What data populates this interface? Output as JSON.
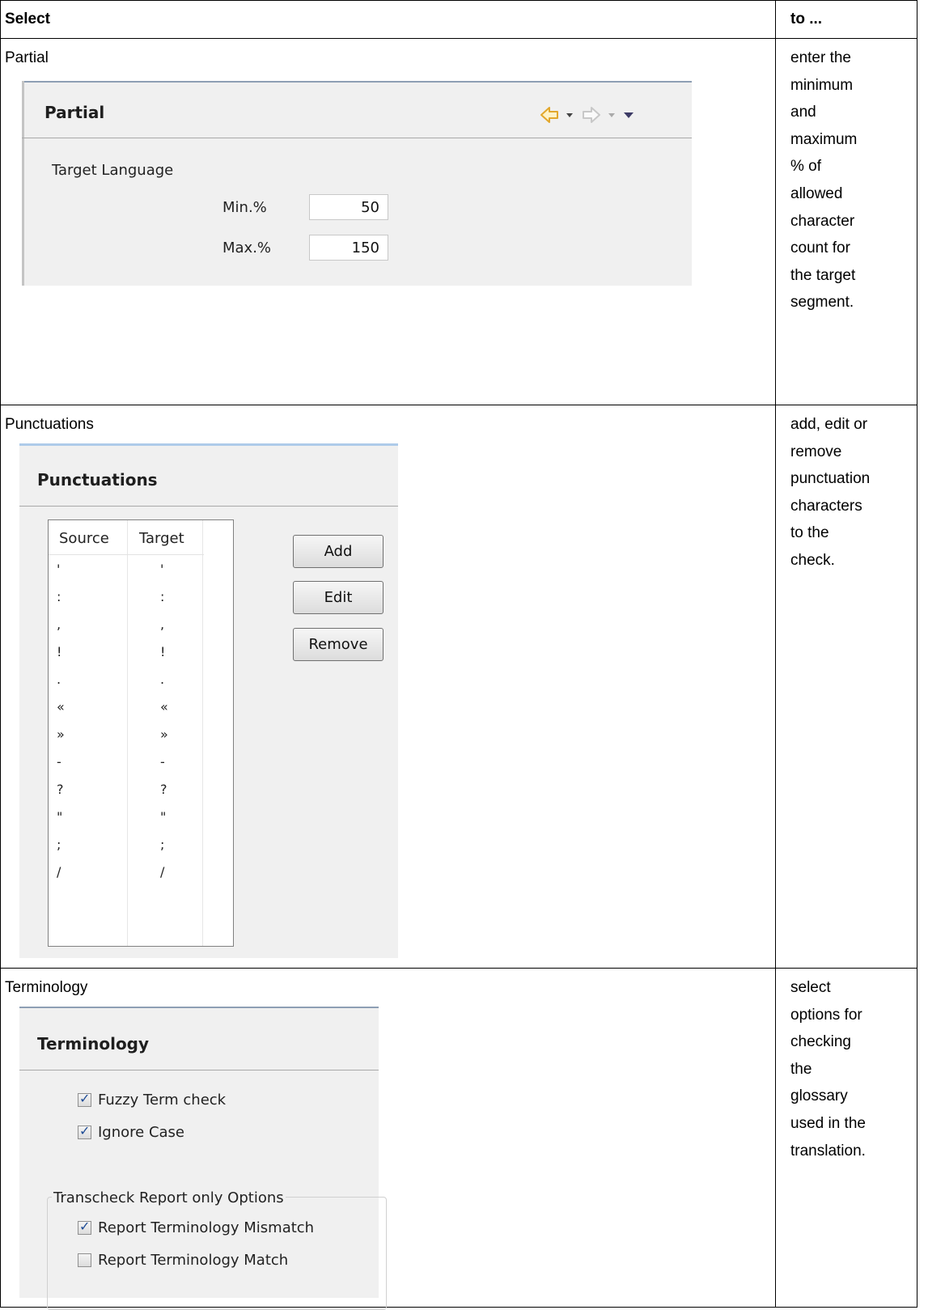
{
  "table": {
    "header": {
      "select": "Select",
      "to": "to ..."
    },
    "rows": [
      {
        "label": "Partial",
        "description": [
          "enter the",
          "minimum",
          "and",
          "maximum",
          "% of",
          "allowed",
          "character",
          "count for",
          "the target",
          "segment."
        ]
      },
      {
        "label": "Punctuations",
        "description": [
          "add, edit or",
          "remove",
          "punctuation",
          "characters",
          "to the",
          "check."
        ]
      },
      {
        "label": "Terminology",
        "description": [
          "select",
          "options for",
          "checking",
          "the",
          "glossary",
          "used in the",
          "translation."
        ]
      }
    ]
  },
  "partial_panel": {
    "title": "Partial",
    "group_label": "Target Language",
    "min_label": "Min.%",
    "min_value": "50",
    "max_label": "Max.%",
    "max_value": "150",
    "icons": [
      "back-arrow-icon",
      "dropdown-icon",
      "forward-arrow-icon",
      "dropdown-icon",
      "view-menu-icon"
    ]
  },
  "punctuations_panel": {
    "title": "Punctuations",
    "columns": [
      "Source",
      "Target"
    ],
    "rows": [
      [
        "'",
        "'"
      ],
      [
        ":",
        ":"
      ],
      [
        ",",
        ","
      ],
      [
        "!",
        "!"
      ],
      [
        ".",
        "."
      ],
      [
        "«",
        "«"
      ],
      [
        "»",
        "»"
      ],
      [
        "-",
        "-"
      ],
      [
        "?",
        "?"
      ],
      [
        "\"",
        "\""
      ],
      [
        ";",
        ";"
      ],
      [
        "/",
        "/"
      ]
    ],
    "buttons": {
      "add": "Add",
      "edit": "Edit",
      "remove": "Remove"
    }
  },
  "terminology_panel": {
    "title": "Terminology",
    "options": [
      {
        "label": "Fuzzy Term check",
        "checked": true
      },
      {
        "label": "Ignore Case",
        "checked": true
      }
    ],
    "group_label": "Transcheck Report only Options",
    "group_options": [
      {
        "label": "Report Terminology Mismatch",
        "checked": true
      },
      {
        "label": "Report Terminology Match",
        "checked": false
      }
    ]
  },
  "colors": {
    "panel_bg": "#f0f0f0",
    "partial_top_border": "#8e9fb4",
    "blue_top_border": "#aecbe9",
    "arrow_back": "#e2a72b",
    "menu_arrow": "#3d3b66"
  }
}
